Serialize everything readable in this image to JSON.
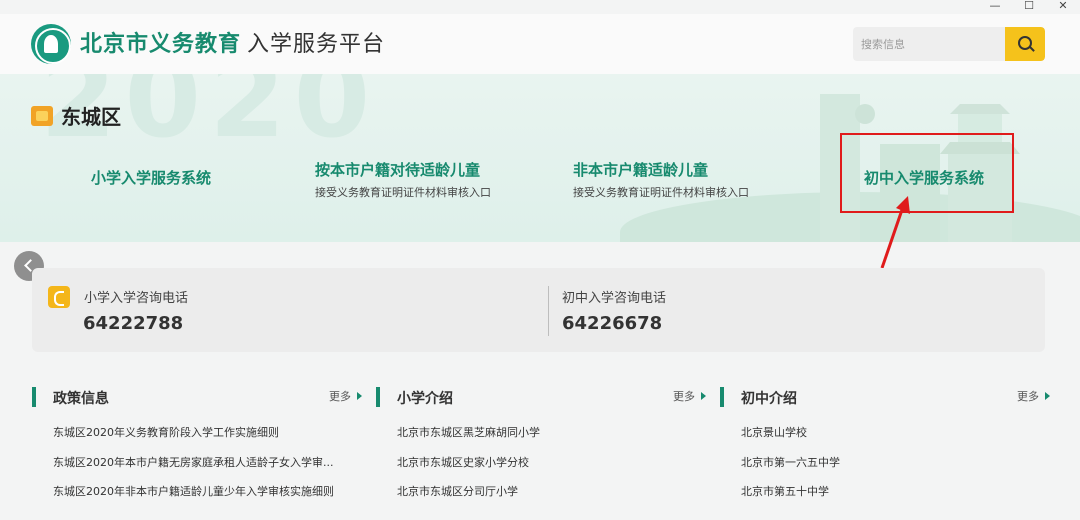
{
  "window": {
    "minimize": "—",
    "maximize": "☐",
    "close": "✕"
  },
  "header": {
    "brand_main": "北京市义务教育",
    "brand_sub": "入学服务平台",
    "search_placeholder": "搜索信息"
  },
  "banner": {
    "district": "东城区",
    "systems": [
      {
        "title": "小学入学服务系统",
        "sub": ""
      },
      {
        "title": "按本市户籍对待适龄儿童",
        "sub": "接受义务教育证明证件材料审核入口"
      },
      {
        "title": "非本市户籍适龄儿童",
        "sub": "接受义务教育证明证件材料审核入口"
      },
      {
        "title": "初中入学服务系统",
        "sub": ""
      }
    ]
  },
  "contact": {
    "primary_label": "小学入学咨询电话",
    "primary_number": "64222788",
    "middle_label": "初中入学咨询电话",
    "middle_number": "64226678"
  },
  "columns": [
    {
      "title": "政策信息",
      "more": "更多",
      "items": [
        "东城区2020年义务教育阶段入学工作实施细则",
        "东城区2020年本市户籍无房家庭承租人适龄子女入学审...",
        "东城区2020年非本市户籍适龄儿童少年入学审核实施细则"
      ]
    },
    {
      "title": "小学介绍",
      "more": "更多",
      "items": [
        "北京市东城区黑芝麻胡同小学",
        "北京市东城区史家小学分校",
        "北京市东城区分司厅小学"
      ]
    },
    {
      "title": "初中介绍",
      "more": "更多",
      "items": [
        "北京景山学校",
        "北京市第一六五中学",
        "北京市第五十中学"
      ]
    }
  ],
  "colors": {
    "brand_green": "#178a6e",
    "accent_yellow": "#f5c21b",
    "annotation_red": "#e01b1b"
  }
}
